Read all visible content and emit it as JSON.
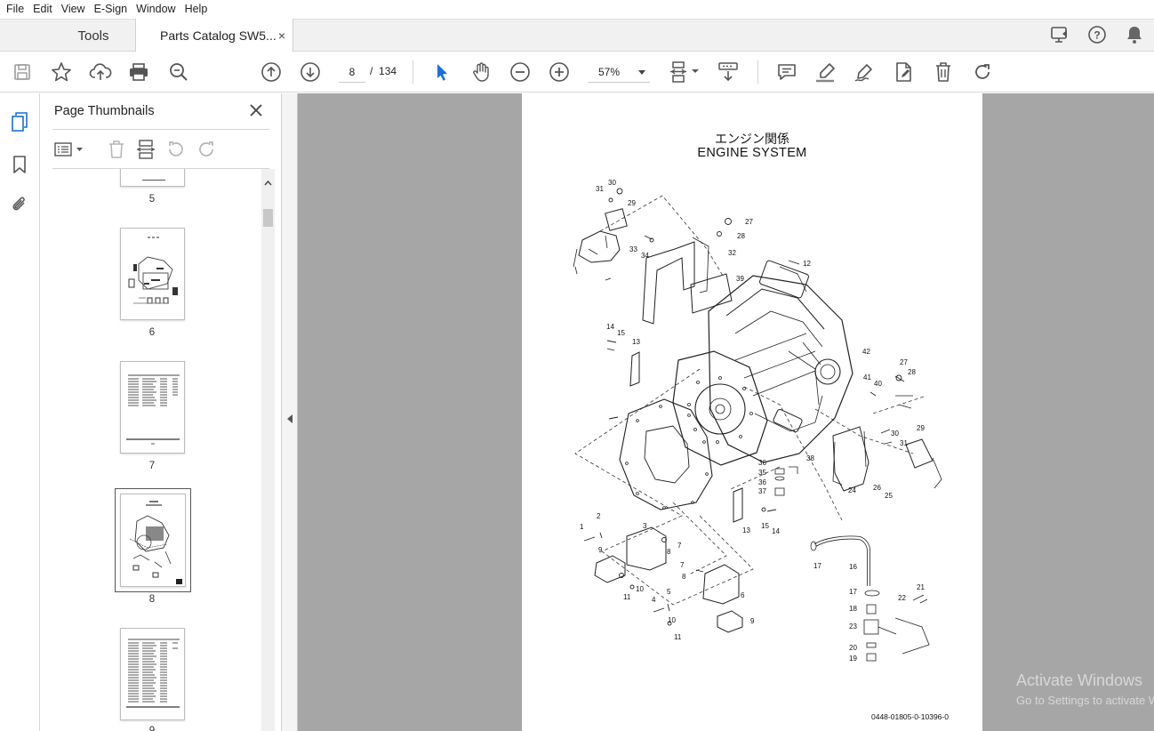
{
  "menu": [
    "File",
    "Edit",
    "View",
    "E-Sign",
    "Window",
    "Help"
  ],
  "tabs": {
    "tools": "Tools",
    "document": "Parts Catalog SW5...",
    "close": "×"
  },
  "toolbar": {
    "page_current": "8",
    "page_sep": "/",
    "page_total": "134",
    "zoom": "57%"
  },
  "panel": {
    "title": "Page Thumbnails"
  },
  "thumbnails": [
    {
      "label": "5"
    },
    {
      "label": "6"
    },
    {
      "label": "7"
    },
    {
      "label": "8",
      "selected": true
    },
    {
      "label": "9"
    }
  ],
  "document": {
    "title_jp": "エンジン関係",
    "title_en": "ENGINE SYSTEM",
    "part_code": "0448-01805-0-10396-0",
    "callouts": [
      "30",
      "31",
      "29",
      "27",
      "28",
      "33",
      "34",
      "32",
      "39",
      "12",
      "14",
      "15",
      "13",
      "42",
      "27",
      "28",
      "41",
      "40",
      "29",
      "30",
      "31",
      "36",
      "35",
      "36",
      "37",
      "38",
      "24",
      "26",
      "25",
      "1",
      "2",
      "3",
      "9",
      "8",
      "7",
      "13",
      "15",
      "14",
      "17",
      "16",
      "7",
      "8",
      "6",
      "10",
      "11",
      "5",
      "4",
      "10",
      "11",
      "9",
      "17",
      "22",
      "21",
      "18",
      "23",
      "20",
      "19"
    ]
  },
  "os": {
    "watermark_title": "Activate Windows",
    "watermark_sub": "Go to Settings to activate Windows."
  }
}
